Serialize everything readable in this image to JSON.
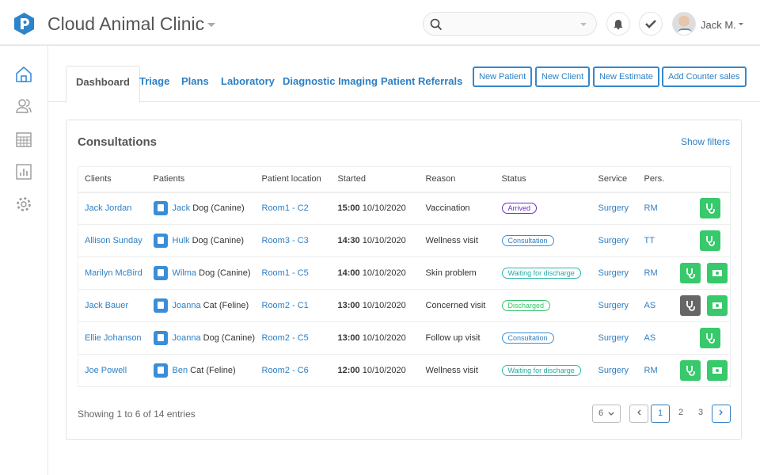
{
  "header": {
    "title": "Cloud Animal Clinic",
    "user": "Jack M.",
    "search_placeholder": ""
  },
  "tabs": [
    "Dashboard",
    "Triage",
    "Plans",
    "Laboratory",
    "Diagnostic Imaging",
    "Patient Referrals"
  ],
  "actions": [
    "New Patient",
    "New Client",
    "New Estimate",
    "Add Counter sales"
  ],
  "card": {
    "title": "Consultations",
    "show_filters": "Show filters"
  },
  "columns": [
    "Clients",
    "Patients",
    "Patient location",
    "Started",
    "Reason",
    "Status",
    "Service",
    "Pers."
  ],
  "rows": [
    {
      "client": "Jack Jordan",
      "patient": "Jack",
      "species": "Dog (Canine)",
      "location": "Room1 - C2",
      "time": "15:00",
      "date": "10/10/2020",
      "reason": "Vaccination",
      "status": "Arrived",
      "service": "Surgery",
      "pers": "RM"
    },
    {
      "client": "Allison Sunday",
      "patient": "Hulk",
      "species": "Dog (Canine)",
      "location": "Room3 - C3",
      "time": "14:30",
      "date": "10/10/2020",
      "reason": "Wellness visit",
      "status": "Consultation",
      "service": "Surgery",
      "pers": "TT"
    },
    {
      "client": "Marilyn McBird",
      "patient": "Wilma",
      "species": "Dog (Canine)",
      "location": "Room1 - C5",
      "time": "14:00",
      "date": "10/10/2020",
      "reason": "Skin problem",
      "status": "Waiting for discharge",
      "service": "Surgery",
      "pers": "RM"
    },
    {
      "client": "Jack Bauer",
      "patient": "Joanna",
      "species": "Cat (Feline)",
      "location": "Room2 - C1",
      "time": "13:00",
      "date": "10/10/2020",
      "reason": "Concerned visit",
      "status": "Discharged",
      "service": "Surgery",
      "pers": "AS"
    },
    {
      "client": "Ellie Johanson",
      "patient": "Joanna",
      "species": "Dog (Canine)",
      "location": "Room2 - C5",
      "time": "13:00",
      "date": "10/10/2020",
      "reason": "Follow up visit",
      "status": "Consultation",
      "service": "Surgery",
      "pers": "AS"
    },
    {
      "client": "Joe Powell",
      "patient": "Ben",
      "species": "Cat (Feline)",
      "location": "Room2 - C6",
      "time": "12:00",
      "date": "10/10/2020",
      "reason": "Wellness visit",
      "status": "Waiting for discharge",
      "service": "Surgery",
      "pers": "RM"
    }
  ],
  "footer": {
    "info": "Showing 1 to 6 of 14 entries",
    "page_size": "6",
    "pages": [
      "1",
      "2",
      "3"
    ]
  }
}
